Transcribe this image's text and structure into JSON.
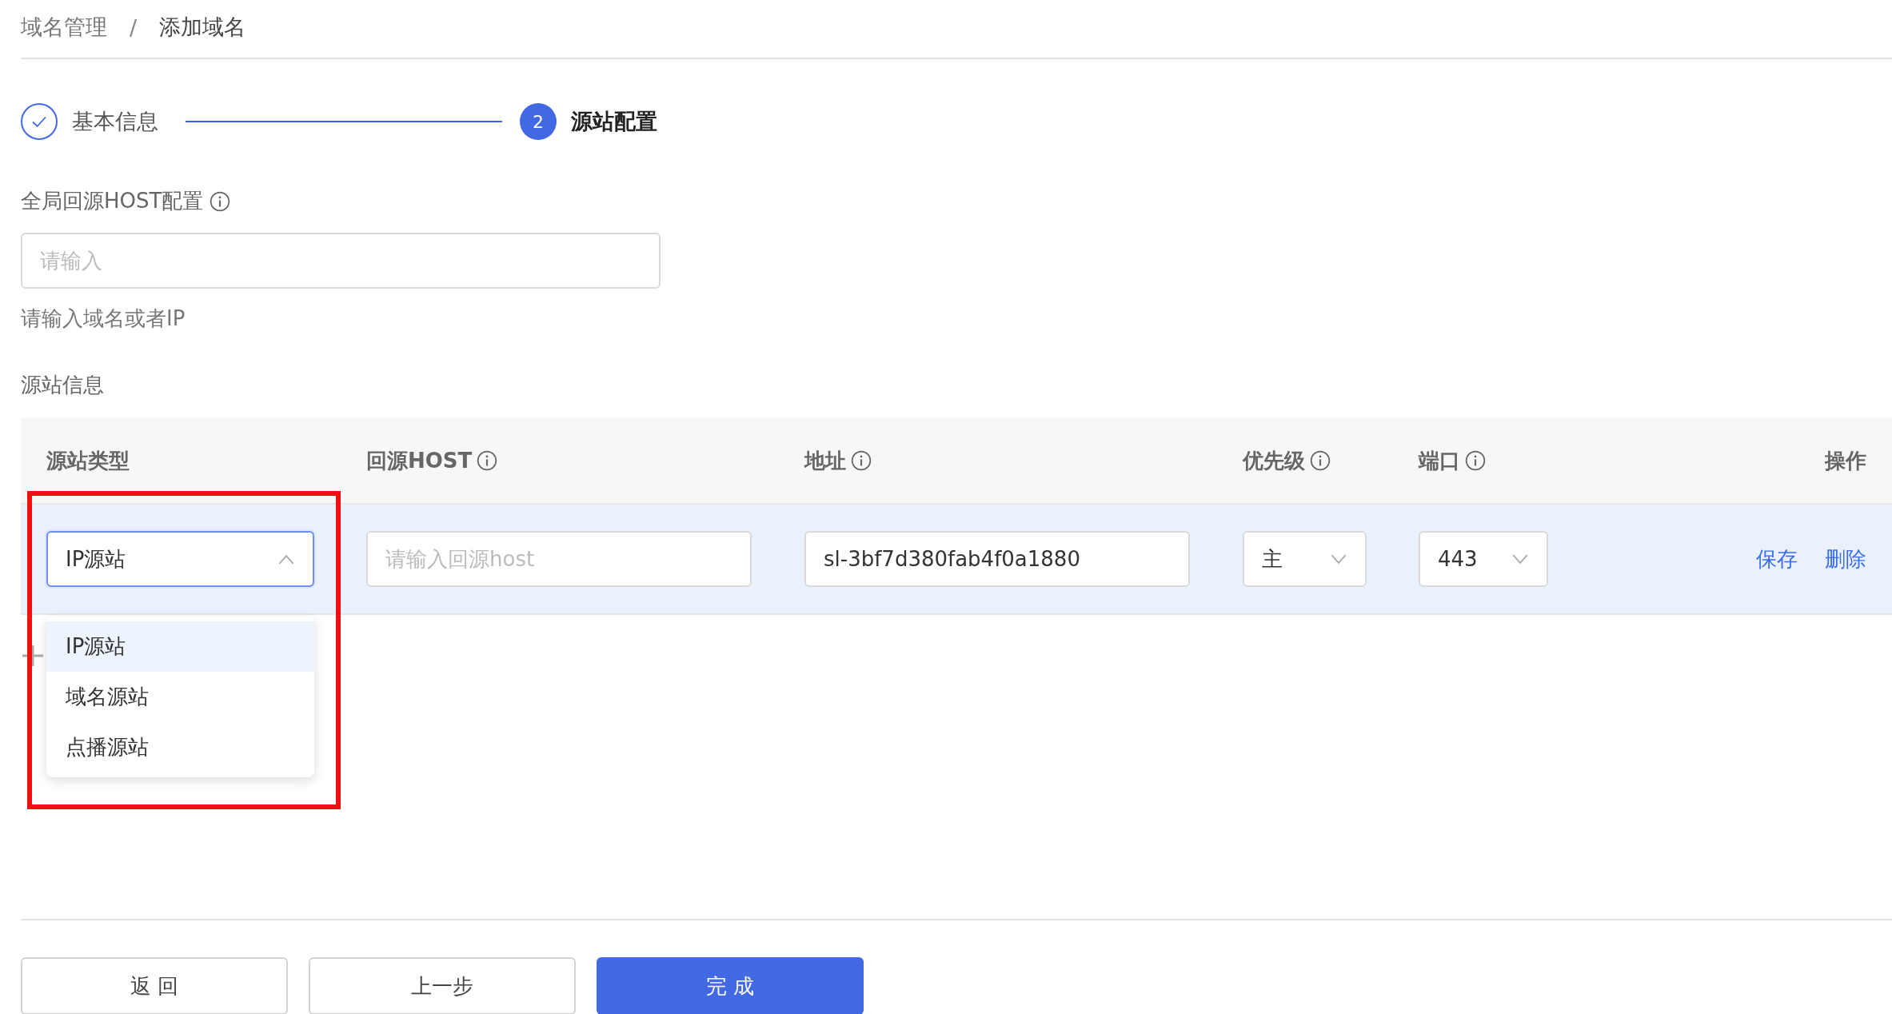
{
  "breadcrumb": {
    "items": [
      {
        "label": "域名管理",
        "current": false
      },
      {
        "label": "添加域名",
        "current": true
      }
    ],
    "separator": "/"
  },
  "steps": [
    {
      "label": "基本信息",
      "kind": "done"
    },
    {
      "label": "源站配置",
      "kind": "current",
      "number": "2"
    }
  ],
  "global_host": {
    "label": "全局回源HOST配置",
    "info": true,
    "placeholder": "请输入",
    "hint": "请输入域名或者IP"
  },
  "origin_info": {
    "title": "源站信息",
    "columns": [
      {
        "label": "源站类型",
        "info": false
      },
      {
        "label": "回源HOST",
        "info": true
      },
      {
        "label": "地址",
        "info": true
      },
      {
        "label": "优先级",
        "info": true
      },
      {
        "label": "端口",
        "info": true
      },
      {
        "label": "操作",
        "info": false
      }
    ],
    "rows": [
      {
        "origin_type": {
          "value": "IP源站",
          "open": true
        },
        "host": {
          "placeholder": "请输入回源host"
        },
        "address": {
          "value": "sl-3bf7d380fab4f0a1880"
        },
        "priority": {
          "value": "主"
        },
        "port": {
          "value": "443"
        },
        "actions": [
          "保存",
          "删除"
        ]
      }
    ],
    "type_options": [
      {
        "label": "IP源站",
        "selected": true
      },
      {
        "label": "域名源站",
        "selected": false
      },
      {
        "label": "点播源站",
        "selected": false
      }
    ],
    "highlight": true
  },
  "buttons": [
    {
      "label": "返 回",
      "kind": "default"
    },
    {
      "label": "上一步",
      "kind": "default"
    },
    {
      "label": "完 成",
      "kind": "primary"
    }
  ]
}
